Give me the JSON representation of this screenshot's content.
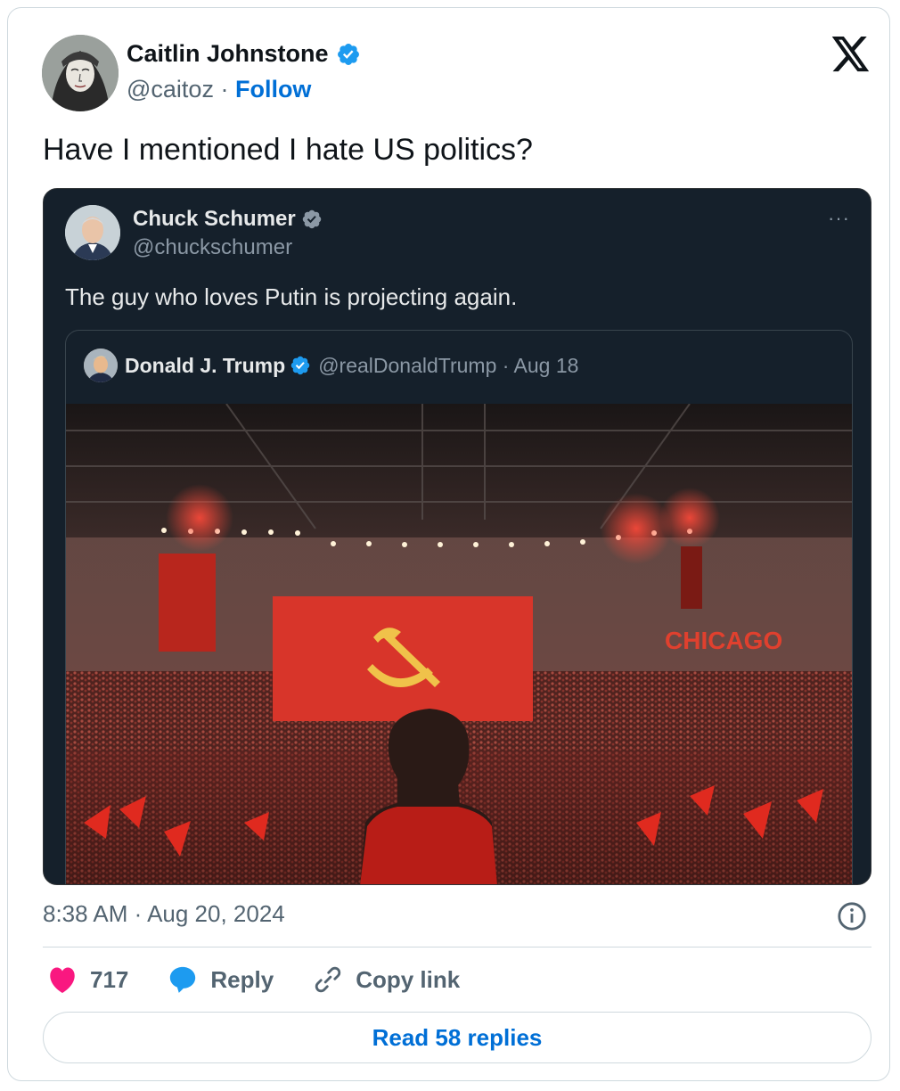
{
  "author": {
    "name": "Caitlin Johnstone",
    "handle": "@caitoz",
    "separator": " · ",
    "follow_label": "Follow",
    "verified_icon": "verified-badge-icon",
    "avatar_icon": "avatar"
  },
  "platform_logo": "x-logo-icon",
  "tweet_text": "Have I mentioned I hate US politics?",
  "quote": {
    "name": "Chuck Schumer",
    "handle": "@chuckschumer",
    "more_icon": "more-dots-icon",
    "more_label": "···",
    "text": "The guy who loves Putin is projecting again.",
    "inner": {
      "name": "Donald J. Trump",
      "handle": "@realDonaldTrump",
      "date": "Aug 18",
      "separator": " · ",
      "media_caption": "CHICAGO"
    }
  },
  "timestamp": "8:38 AM · Aug 20, 2024",
  "actions": {
    "like_count": "717",
    "reply_label": "Reply",
    "copy_label": "Copy link"
  },
  "read_replies_label": "Read 58 replies",
  "colors": {
    "accent_blue": "#006fd6",
    "verified_blue": "#1d9bf0",
    "like_pink": "#f91880",
    "dark_bg": "#15202b"
  }
}
